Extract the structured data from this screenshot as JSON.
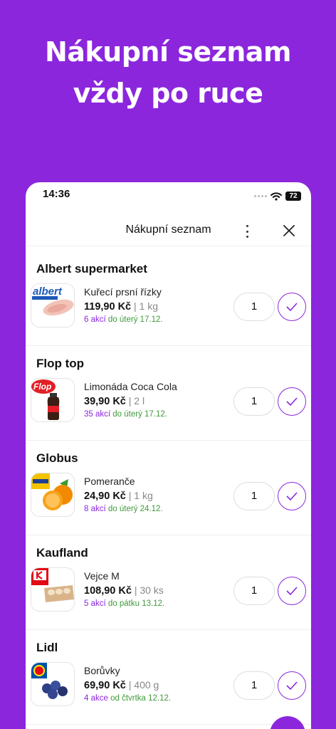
{
  "hero": {
    "line1": "Nákupní seznam",
    "line2": "vždy po ruce"
  },
  "status_bar": {
    "time": "14:36",
    "battery": "72"
  },
  "navbar": {
    "title": "Nákupní seznam",
    "more_icon": "more-vertical-icon",
    "close_icon": "close-icon"
  },
  "colors": {
    "accent": "#8B26DD",
    "green": "#3F9A3A"
  },
  "stores": [
    {
      "store": "Albert supermarket",
      "product": "Kuřecí prsní řízky",
      "price": "119,90 Kč",
      "unit": "| 1 kg",
      "deals_count": "6 akcí",
      "deals_until": "do úterý 17.12.",
      "quantity": "1"
    },
    {
      "store": "Flop top",
      "product": "Limonáda Coca Cola",
      "price": "39,90 Kč",
      "unit": "| 2 l",
      "deals_count": "35 akcí",
      "deals_until": "do úterý 17.12.",
      "quantity": "1"
    },
    {
      "store": "Globus",
      "product": "Pomeranče",
      "price": "24,90 Kč",
      "unit": "| 1 kg",
      "deals_count": "8 akcí",
      "deals_until": "do úterý 24.12.",
      "quantity": "1"
    },
    {
      "store": "Kaufland",
      "product": "Vejce M",
      "price": "108,90 Kč",
      "unit": "| 30 ks",
      "deals_count": "5 akcí",
      "deals_until": "do pátku 13.12.",
      "quantity": "1"
    },
    {
      "store": "Lidl",
      "product": "Borůvky",
      "price": "69,90 Kč",
      "unit": "| 400 g",
      "deals_count": "4 akce",
      "deals_until": "od čtvrtka 12.12.",
      "quantity": "1"
    }
  ]
}
